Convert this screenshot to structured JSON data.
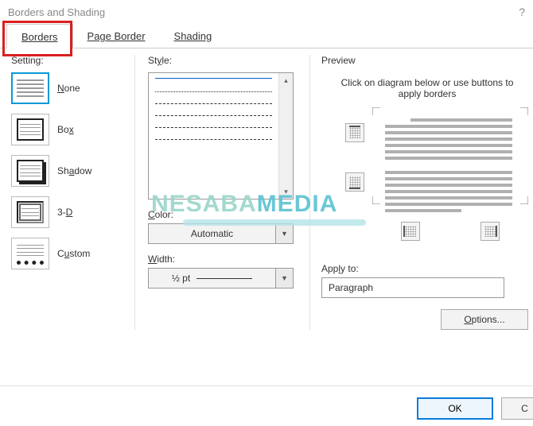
{
  "title": "Borders and Shading",
  "help": "?",
  "tabs": {
    "borders": "Borders",
    "page_border": "Page Border",
    "shading": "Shading"
  },
  "setting": {
    "label": "Setting:",
    "none": "None",
    "box": "Box",
    "shadow": "Shadow",
    "three_d": "3-D",
    "custom": "Custom"
  },
  "style": {
    "label": "Style:",
    "color_label": "Color:",
    "color_value": "Automatic",
    "width_label": "Width:",
    "width_value": "½ pt"
  },
  "preview": {
    "label": "Preview",
    "hint": "Click on diagram below or use buttons to apply borders",
    "apply_label": "Apply to:",
    "apply_value": "Paragraph",
    "options": "Options..."
  },
  "buttons": {
    "ok": "OK",
    "cancel": "Cancel"
  },
  "watermark": {
    "a": "NESABA",
    "b": "MEDIA"
  }
}
